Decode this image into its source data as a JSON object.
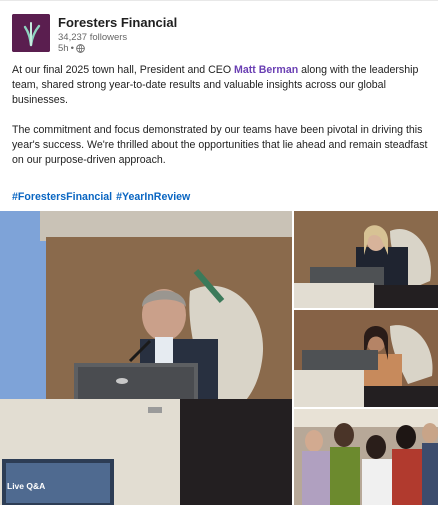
{
  "post": {
    "org_name": "Foresters Financial",
    "followers": "34,237 followers",
    "time": "5h",
    "separator": "•",
    "visibility_icon": "globe-icon",
    "text_part1_before": "At our final 2025 town hall, President and CEO ",
    "mention": "Matt Berman",
    "text_part1_after": " along with the leadership team, shared strong year-to-date results and valuable insights across our global businesses.",
    "text_part2": "The commitment and focus demonstrated by our teams have been pivotal in driving this year's success. We're thrilled about the opportunities that lie ahead and remain steadfast on our purpose-driven approach.",
    "hashtags": [
      "#ForestersFinancial",
      "#YearInReview"
    ]
  },
  "gallery": {
    "screen_label": "Live Q&A"
  },
  "colors": {
    "brand": "#5a1e4f",
    "link": "#0a66c2",
    "mention": "#6a3fb3"
  }
}
